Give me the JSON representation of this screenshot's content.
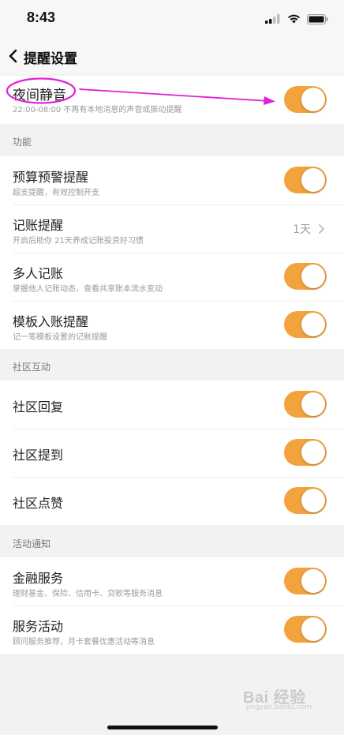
{
  "status_bar": {
    "time": "8:43",
    "icons": [
      "signal-icon",
      "wifi-icon",
      "battery-icon"
    ]
  },
  "nav": {
    "title": "提醒设置",
    "back_icon": "chevron-left-icon"
  },
  "night_mute": {
    "title": "夜间静音",
    "subtitle": "22:00-08:00 不再有本地消息的声音或振动提醒",
    "enabled": true
  },
  "sections": {
    "features": {
      "header": "功能",
      "items": [
        {
          "title": "预算预警提醒",
          "subtitle": "超支提醒，有效控制开支",
          "enabled": true
        },
        {
          "title": "记账提醒",
          "subtitle": "开启后助你 21天养成记账投资好习惯",
          "value": "1天"
        },
        {
          "title": "多人记账",
          "subtitle": "掌握他人记账动态，查看共享账本流水变动",
          "enabled": true
        },
        {
          "title": "模板入账提醒",
          "subtitle": "记一笔模板设置的记账提醒",
          "enabled": true
        }
      ]
    },
    "community": {
      "header": "社区互动",
      "items": [
        {
          "title": "社区回复",
          "enabled": true
        },
        {
          "title": "社区提到",
          "enabled": true
        },
        {
          "title": "社区点赞",
          "enabled": true
        }
      ]
    },
    "activity": {
      "header": "活动通知",
      "items": [
        {
          "title": "金融服务",
          "subtitle": "理财基金、保险、信用卡、贷款等服务消息",
          "enabled": true
        },
        {
          "title": "服务活动",
          "subtitle": "顾问服务推荐，月卡套餐优惠活动等消息",
          "enabled": true
        }
      ]
    }
  },
  "watermark": {
    "text": "Bai 经验",
    "sub": "jingyan.baidu.com"
  },
  "colors": {
    "toggle_on": "#f2a33c",
    "annotation": "#e020d8",
    "background": "#f2f2f2"
  }
}
